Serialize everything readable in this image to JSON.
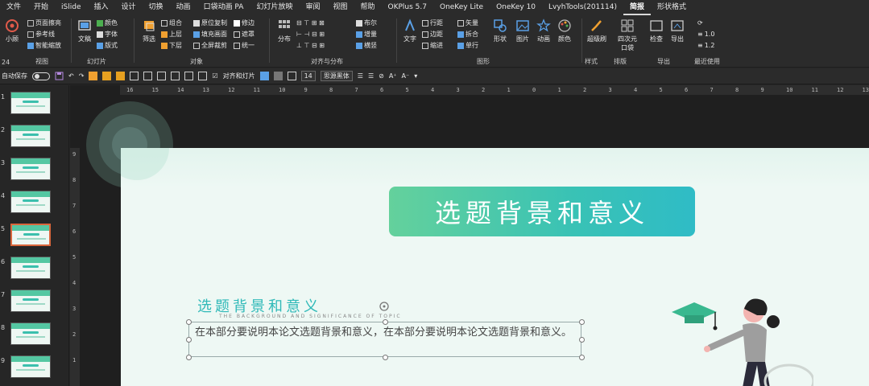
{
  "menu": [
    "文件",
    "开始",
    "iSlide",
    "插入",
    "设计",
    "切换",
    "动画",
    "口袋动画 PA",
    "幻灯片放映",
    "审阅",
    "视图",
    "帮助",
    "OKPlus 5.7",
    "OneKey Lite",
    "OneKey 10",
    "LvyhTools(201114)",
    "简报",
    "形状格式"
  ],
  "menu_active_index": 16,
  "ribbon": {
    "group_labels": [
      "24",
      "视图",
      "幻灯片",
      "对象",
      "对齐与分布",
      "图形",
      "样式",
      "排版",
      "导出",
      "最近使用"
    ],
    "g1": {
      "small_btn": "小顾",
      "view_items": [
        "页面擦亮",
        "参考线",
        "智能缩放"
      ]
    },
    "g2": {
      "big": "文稿",
      "items": [
        "颜色",
        "字体",
        "版式"
      ]
    },
    "g3": {
      "big": "筛选",
      "items": [
        "组合",
        "上层",
        "下层"
      ],
      "items2": [
        "原位复制",
        "填充画面",
        "全屏裁剪"
      ],
      "items3": [
        "修边",
        "遮罩",
        "统一"
      ]
    },
    "g4": {
      "big": "分布",
      "items": [
        "布尔",
        "增量",
        "横竖"
      ]
    },
    "g5": {
      "big": "文字",
      "items": [
        "行距",
        "边距",
        "缩进"
      ],
      "items2": [
        "矢量",
        "拆合",
        "单行"
      ],
      "bigs": [
        "形状",
        "图片",
        "动画",
        "颜色"
      ]
    },
    "g6": {
      "bigs": [
        "超级刷",
        "四次元口袋",
        "检查",
        "导出"
      ],
      "recent": [
        "1.0",
        "1.2"
      ]
    }
  },
  "qat": {
    "autosave": "自动保存",
    "align_label": "对齐和灯片",
    "font_size": "14",
    "font_name": "思源黑体"
  },
  "ruler_top": [
    "16",
    "15",
    "14",
    "13",
    "12",
    "11",
    "10",
    "9",
    "8",
    "7",
    "6",
    "5",
    "4",
    "3",
    "2",
    "1",
    "0",
    "1",
    "2",
    "3",
    "4",
    "5",
    "6",
    "7",
    "8",
    "9",
    "10",
    "11",
    "12",
    "13"
  ],
  "ruler_left": [
    "9",
    "8",
    "7",
    "6",
    "5",
    "4",
    "3",
    "2",
    "1"
  ],
  "thumb_numbers": [
    "1",
    "2",
    "3",
    "4",
    "5",
    "6",
    "7",
    "8",
    "9"
  ],
  "selected_thumb": 5,
  "slide": {
    "title": "选题背景和意义",
    "subtitle": "选题背景和意义",
    "subtitle_en": "THE BACKGROUND AND SIGNIFICANCE OF TOPIC",
    "body": "在本部分要说明本论文选题背景和意义，在本部分要说明本论文选题背景和意义。"
  },
  "colors": {
    "accent": "#39c2b5",
    "accent2": "#64d19c",
    "selection": "#d9673c"
  }
}
